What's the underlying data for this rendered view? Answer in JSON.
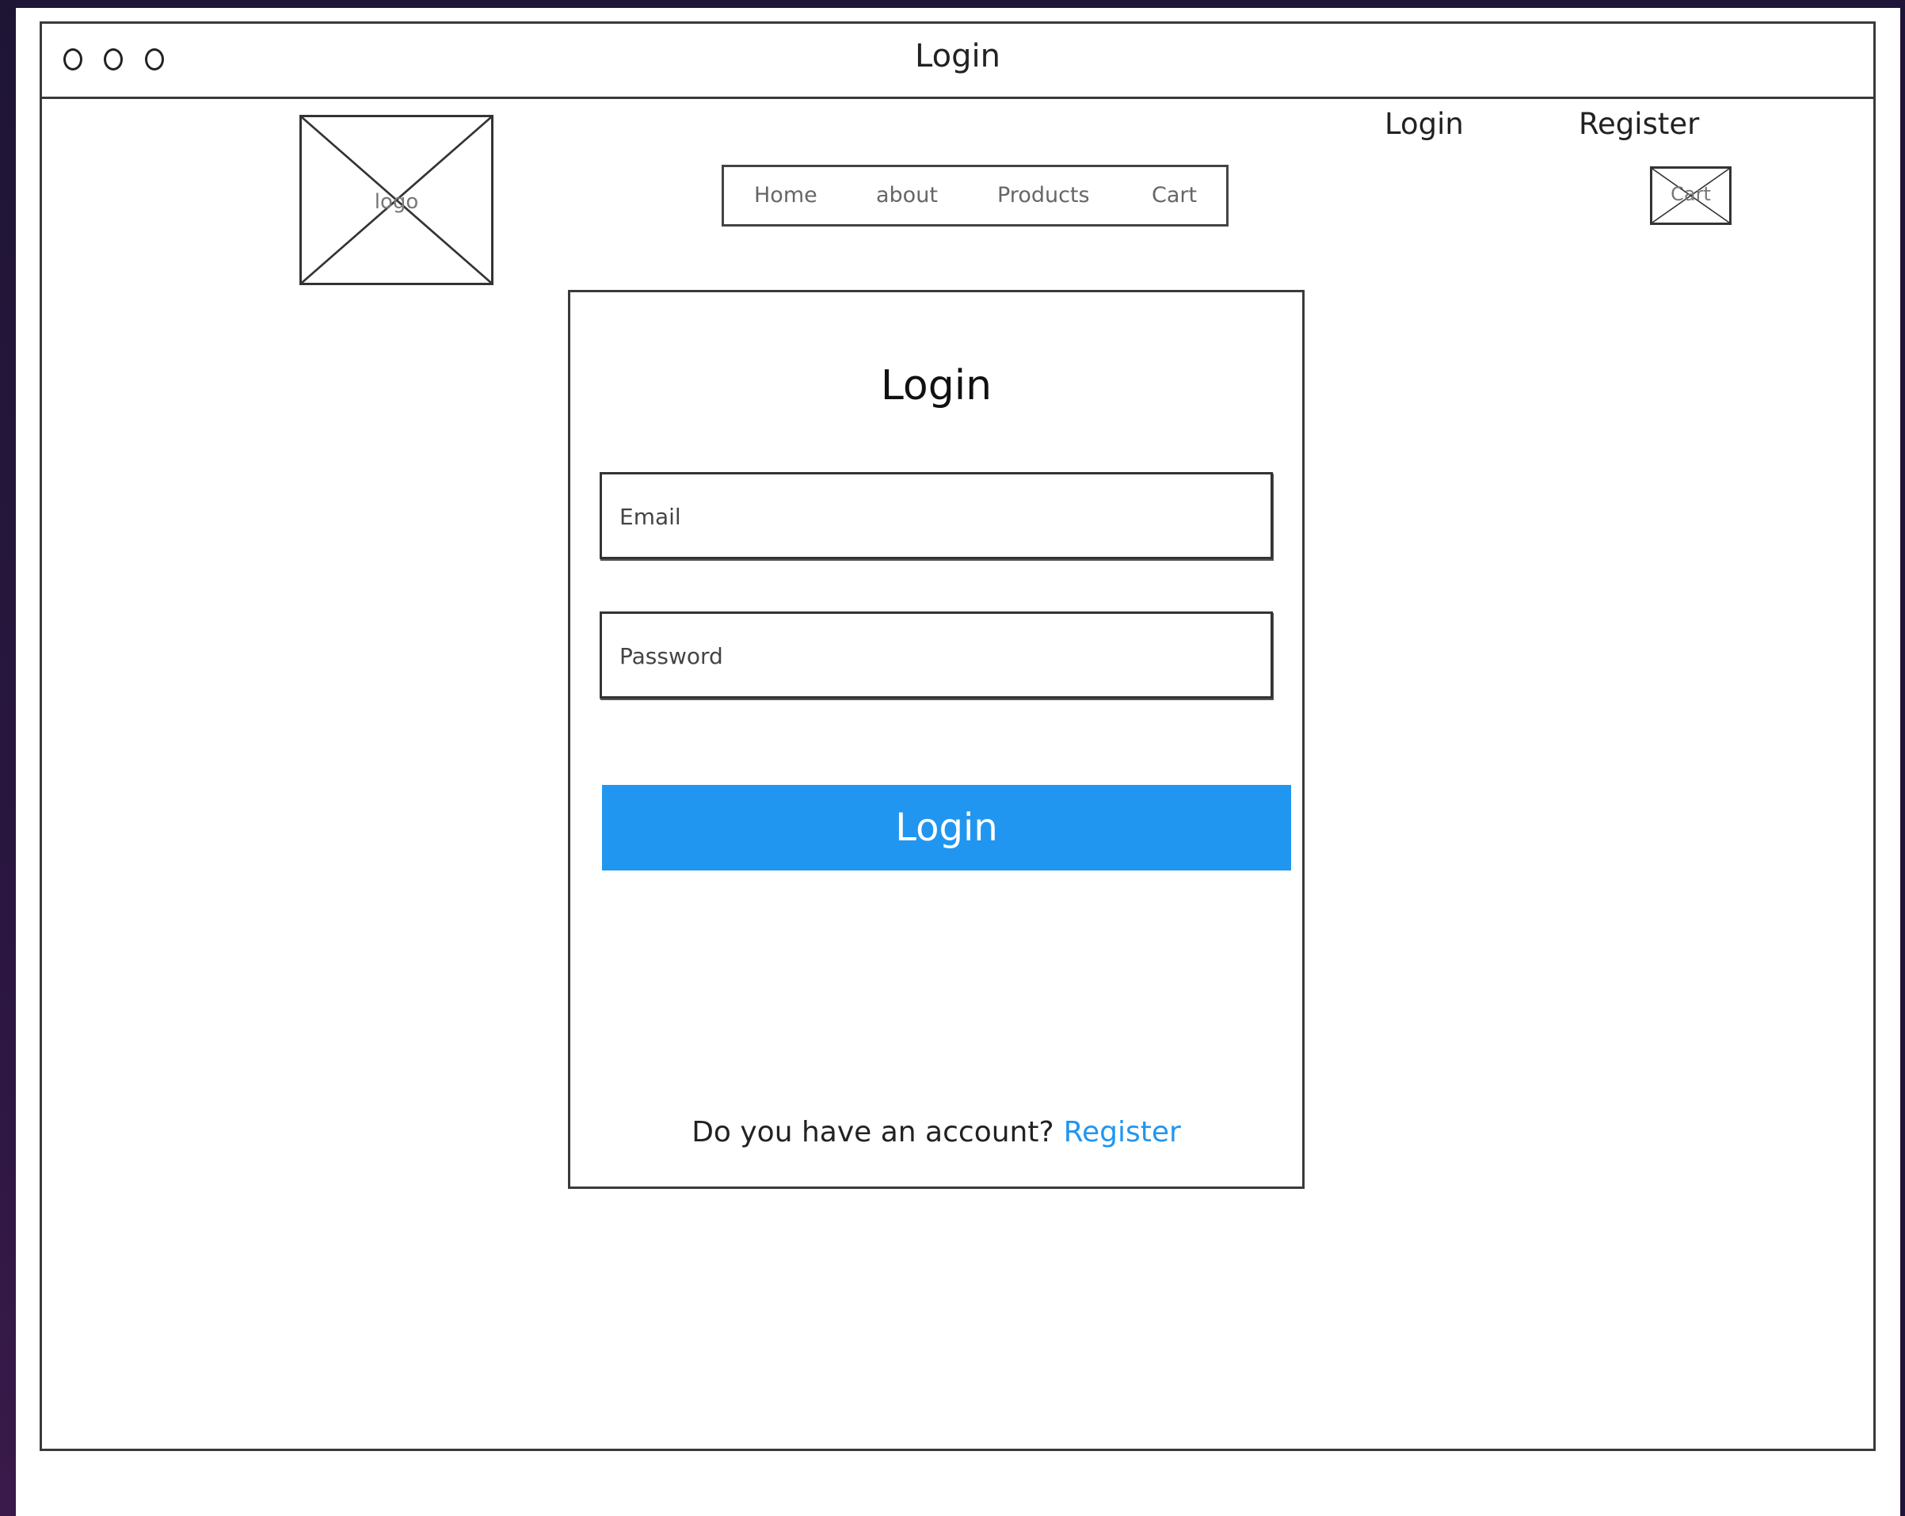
{
  "window": {
    "title": "Login"
  },
  "header": {
    "logo_label": "logo",
    "nav": [
      {
        "label": "Home"
      },
      {
        "label": "about"
      },
      {
        "label": "Products"
      },
      {
        "label": "Cart"
      }
    ],
    "top_links": {
      "login": "Login",
      "register": "Register"
    },
    "cart_label": "Cart"
  },
  "login_form": {
    "title": "Login",
    "email_placeholder": "Email",
    "password_placeholder": "Password",
    "submit_label": "Login",
    "footer_text": "Do you have an account?",
    "register_link": "Register"
  },
  "colors": {
    "accent": "#2196f0",
    "frame": "#1f1538"
  }
}
